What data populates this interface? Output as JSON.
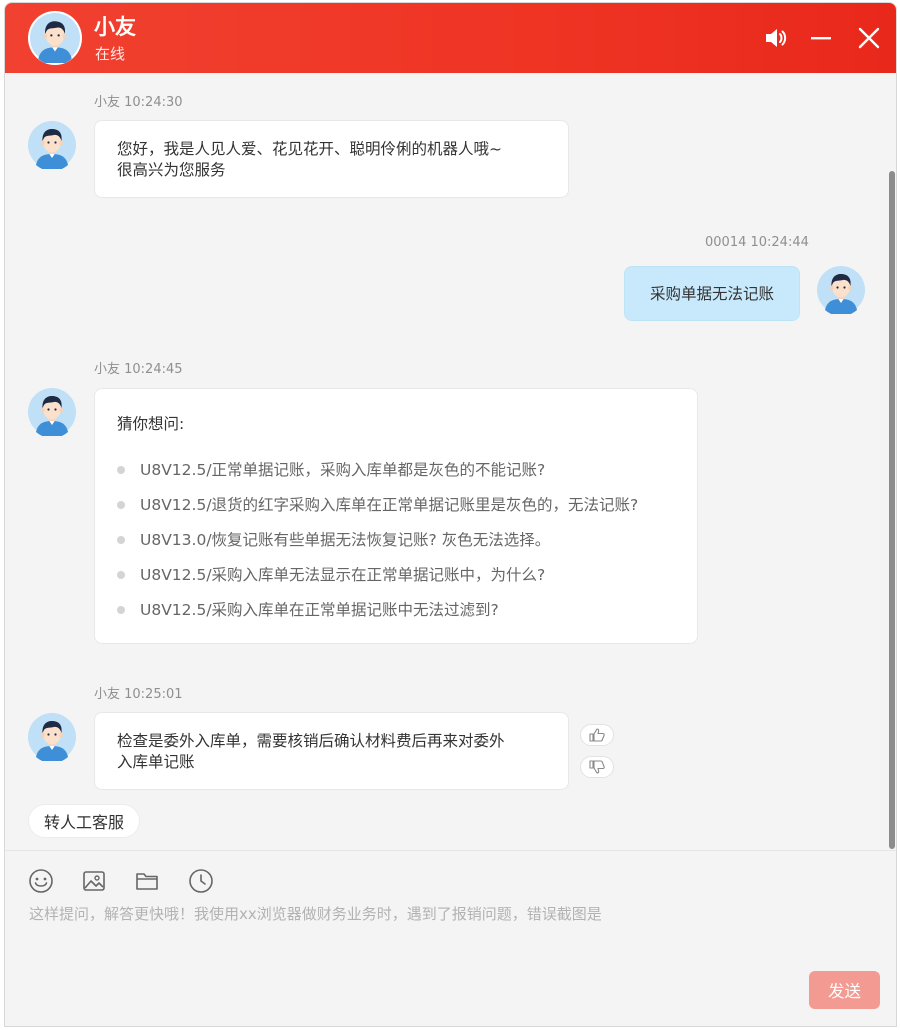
{
  "header": {
    "name": "小友",
    "status": "在线"
  },
  "colors": {
    "header_bg": "#ef3424",
    "user_bubble": "#c7e9fb",
    "send_button": "#f39a92"
  },
  "messages": [
    {
      "sender": "小友",
      "time": "10:24:30",
      "meta": "小友 10:24:30",
      "lines": [
        "您好，我是人见人爱、花见花开、聪明伶俐的机器人哦~",
        "很高兴为您服务"
      ]
    },
    {
      "sender": "00014",
      "time": "10:24:44",
      "meta": "00014 10:24:44",
      "text": "采购单据无法记账"
    },
    {
      "sender": "小友",
      "time": "10:24:45",
      "meta": "小友 10:24:45",
      "title": "猜你想问:",
      "suggestions": [
        "U8V12.5/正常单据记账，采购入库单都是灰色的不能记账?",
        "U8V12.5/退货的红字采购入库单在正常单据记账里是灰色的，无法记账?",
        "U8V13.0/恢复记账有些单据无法恢复记账? 灰色无法选择。",
        "U8V12.5/采购入库单无法显示在正常单据记账中，为什么?",
        "U8V12.5/采购入库单在正常单据记账中无法过滤到?"
      ]
    },
    {
      "sender": "小友",
      "time": "10:25:01",
      "meta": "小友 10:25:01",
      "lines": [
        "检查是委外入库单，需要核销后确认材料费后再来对委外",
        "入库单记账"
      ]
    }
  ],
  "transfer_label": "转人工客服",
  "toolbar": {
    "icons": [
      "emoji-icon",
      "image-icon",
      "folder-icon",
      "history-icon"
    ]
  },
  "input": {
    "placeholder": "这样提问，解答更快哦！我使用xx浏览器做财务业务时，遇到了报销问题，错误截图是"
  },
  "send_label": "发送"
}
